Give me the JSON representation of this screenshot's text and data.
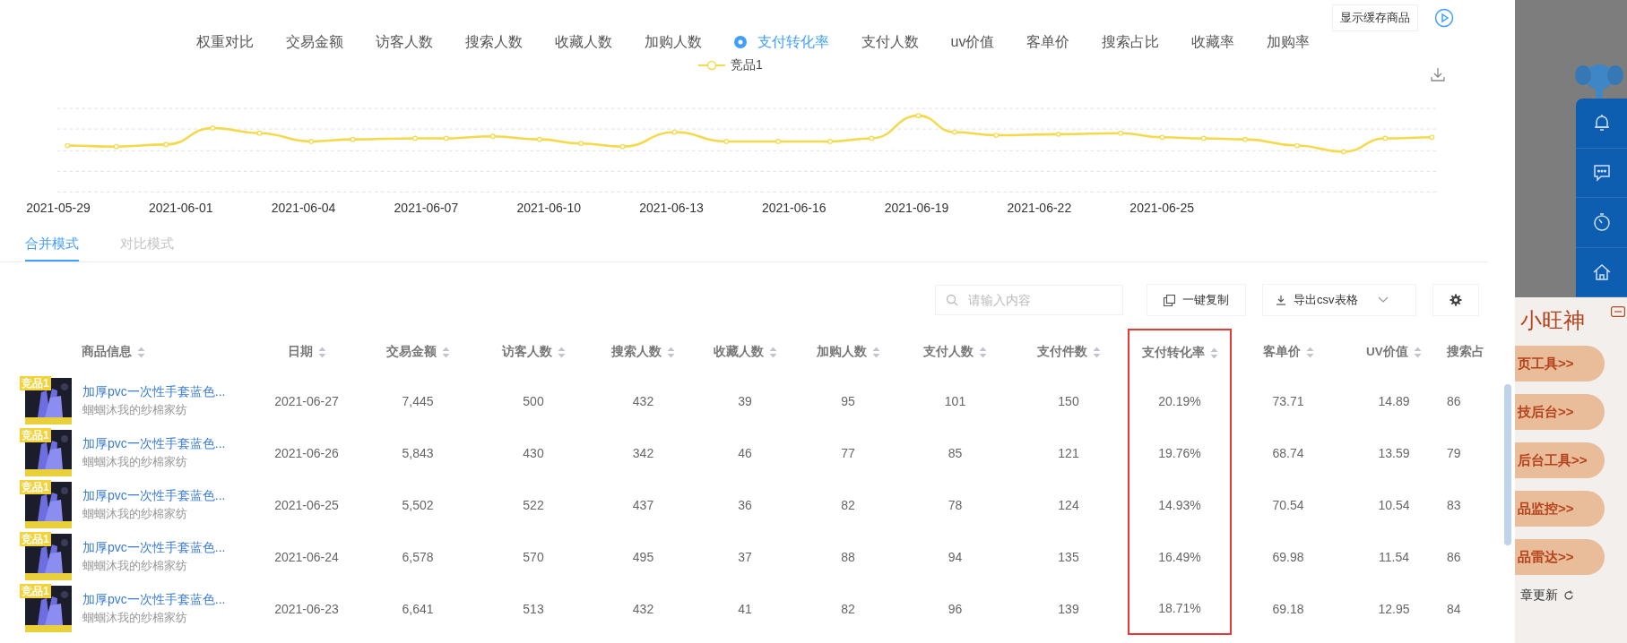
{
  "top_button": {
    "label": "显示缓存商品"
  },
  "metrics": [
    {
      "label": "权重对比",
      "selected": false
    },
    {
      "label": "交易金额",
      "selected": false
    },
    {
      "label": "访客人数",
      "selected": false
    },
    {
      "label": "搜索人数",
      "selected": false
    },
    {
      "label": "收藏人数",
      "selected": false
    },
    {
      "label": "加购人数",
      "selected": false
    },
    {
      "label": "支付转化率",
      "selected": true
    },
    {
      "label": "支付人数",
      "selected": false
    },
    {
      "label": "uv价值",
      "selected": false
    },
    {
      "label": "客单价",
      "selected": false
    },
    {
      "label": "搜索占比",
      "selected": false
    },
    {
      "label": "收藏率",
      "selected": false
    },
    {
      "label": "加购率",
      "selected": false
    }
  ],
  "legend": {
    "label": "竞品1"
  },
  "chart_dates": [
    "2021-05-29",
    "2021-06-01",
    "2021-06-04",
    "2021-06-07",
    "2021-06-10",
    "2021-06-13",
    "2021-06-16",
    "2021-06-19",
    "2021-06-22",
    "2021-06-25"
  ],
  "modes": [
    {
      "label": "合并模式",
      "selected": true
    },
    {
      "label": "对比模式",
      "selected": false
    }
  ],
  "toolbar": {
    "search_placeholder": "请输入内容",
    "copy_button": "一键复制",
    "export_dropdown": "导出csv表格"
  },
  "table": {
    "columns": [
      {
        "label": "商品信息",
        "highlighted": false
      },
      {
        "label": "日期",
        "highlighted": false
      },
      {
        "label": "交易金额",
        "highlighted": false
      },
      {
        "label": "访客人数",
        "highlighted": false
      },
      {
        "label": "搜索人数",
        "highlighted": false
      },
      {
        "label": "收藏人数",
        "highlighted": false
      },
      {
        "label": "加购人数",
        "highlighted": false
      },
      {
        "label": "支付人数",
        "highlighted": false
      },
      {
        "label": "支付件数",
        "highlighted": false
      },
      {
        "label": "支付转化率",
        "highlighted": true
      },
      {
        "label": "客单价",
        "highlighted": false
      },
      {
        "label": "UV价值",
        "highlighted": false
      },
      {
        "label": "搜索占",
        "highlighted": false
      }
    ],
    "rows": [
      {
        "cells": [
          {
            "badge": "竞品1",
            "title": "加厚pvc一次性手套蓝色...",
            "shop": "蝈蝈沐我的纱棉家纺"
          },
          "2021-06-27",
          "7,445",
          "500",
          "432",
          "39",
          "95",
          "101",
          "150",
          "20.19%",
          "73.71",
          "14.89",
          "86"
        ]
      },
      {
        "cells": [
          {
            "badge": "竞品1",
            "title": "加厚pvc一次性手套蓝色...",
            "shop": "蝈蝈沐我的纱棉家纺"
          },
          "2021-06-26",
          "5,843",
          "430",
          "342",
          "46",
          "77",
          "85",
          "121",
          "19.76%",
          "68.74",
          "13.59",
          "79"
        ]
      },
      {
        "cells": [
          {
            "badge": "竞品1",
            "title": "加厚pvc一次性手套蓝色...",
            "shop": "蝈蝈沐我的纱棉家纺"
          },
          "2021-06-25",
          "5,502",
          "522",
          "437",
          "36",
          "82",
          "78",
          "124",
          "14.93%",
          "70.54",
          "10.54",
          "83"
        ]
      },
      {
        "cells": [
          {
            "badge": "竞品1",
            "title": "加厚pvc一次性手套蓝色...",
            "shop": "蝈蝈沐我的纱棉家纺"
          },
          "2021-06-24",
          "6,578",
          "570",
          "495",
          "37",
          "88",
          "94",
          "135",
          "16.49%",
          "69.98",
          "11.54",
          "86"
        ]
      },
      {
        "cells": [
          {
            "badge": "竞品1",
            "title": "加厚pvc一次性手套蓝色...",
            "shop": "蝈蝈沐我的纱棉家纺"
          },
          "2021-06-23",
          "6,641",
          "513",
          "432",
          "41",
          "82",
          "96",
          "139",
          "18.71%",
          "69.18",
          "12.95",
          "84"
        ]
      }
    ]
  },
  "side_promo": {
    "logo": "小旺神",
    "buttons": [
      "页工具>>",
      "技后台>>",
      "后台工具>>",
      "品监控>>",
      "品雷达>>"
    ],
    "update_link": "章更新"
  }
}
